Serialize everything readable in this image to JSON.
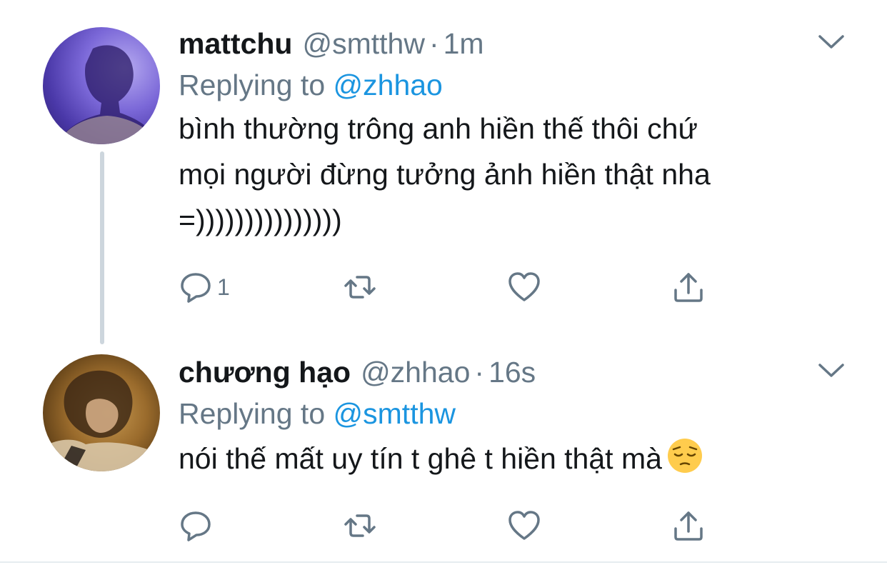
{
  "tweets": [
    {
      "name": "mattchu",
      "handle": "@smtthw",
      "separator": "·",
      "time": "1m",
      "replying_prefix": "Replying to",
      "replying_to": "@zhhao",
      "text": "bình thường trông anh hiền thế thôi chứ\nmọi người đừng tưởng ảnh hiền thật nha\n=)))))))))))))))",
      "reply_count": "1",
      "avatar_color": "#7b68d8"
    },
    {
      "name": "chương hạo",
      "handle": "@zhhao",
      "separator": "·",
      "time": "16s",
      "replying_prefix": "Replying to",
      "replying_to": "@smtthw",
      "text": "nói thế mất uy tín t ghê t hiền thật mà",
      "emoji": "pensive-face",
      "reply_count": "",
      "avatar_color": "#9a6b2c"
    }
  ],
  "icons": {
    "reply": "speech-bubble-icon",
    "retweet": "retweet-icon",
    "like": "heart-icon",
    "share": "share-icon",
    "more": "chevron-down-icon"
  },
  "colors": {
    "link": "#1b95e0",
    "secondary_text": "#657786",
    "primary_text": "#14171a",
    "thread_line": "#cdd6dd"
  }
}
